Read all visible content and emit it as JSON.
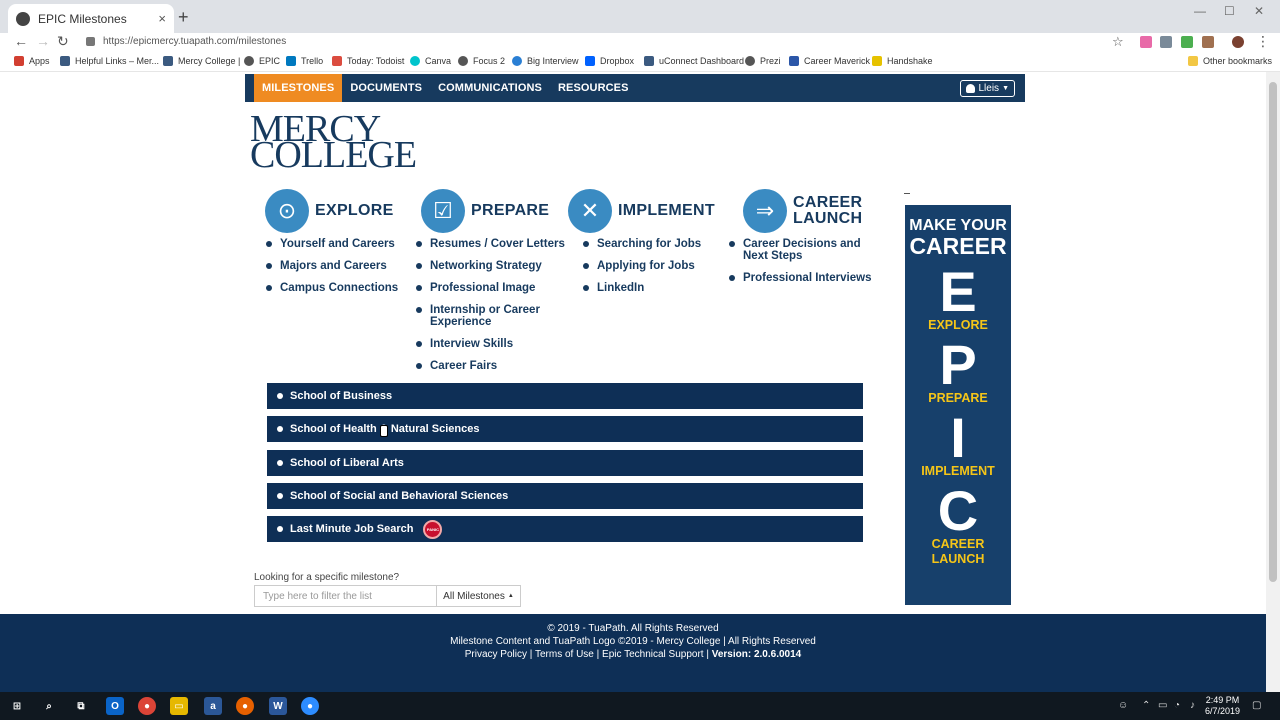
{
  "browser": {
    "tab_title": "EPIC Milestones",
    "tab_close": "×",
    "new_tab": "+",
    "url": "https://epicmercy.tuapath.com/milestones",
    "bookmarks": [
      "Apps",
      "Helpful Links – Mer...",
      "Mercy College |",
      "EPIC",
      "Trello",
      "Today: Todoist",
      "Canva",
      "Focus 2",
      "Big Interview",
      "Dropbox",
      "uConnect Dashboard",
      "Prezi",
      "Career Maverick",
      "Handshake"
    ],
    "other_bookmarks": "Other bookmarks"
  },
  "nav": {
    "items": [
      "MILESTONES",
      "DOCUMENTS",
      "COMMUNICATIONS",
      "RESOURCES"
    ],
    "active": "MILESTONES",
    "user_label": "Lleis",
    "accent_color": "#ef8b22",
    "bar_color": "#173a5e"
  },
  "logo": {
    "line1": "MERCY",
    "line2": "COLLEGE"
  },
  "categories": [
    {
      "title": "EXPLORE",
      "icon": "binoculars-icon",
      "items": [
        "Yourself and Careers",
        "Majors and Careers",
        "Campus Connections"
      ]
    },
    {
      "title": "PREPARE",
      "icon": "checklist-icon",
      "items": [
        "Resumes / Cover Letters",
        "Networking Strategy",
        "Professional Image",
        "Internship or Career Experience",
        "Interview Skills",
        "Career Fairs"
      ]
    },
    {
      "title": "IMPLEMENT",
      "icon": "tools-icon",
      "items": [
        "Searching for Jobs",
        "Applying for Jobs",
        "LinkedIn"
      ]
    },
    {
      "title_line1": "CAREER",
      "title_line2": "LAUNCH",
      "icon": "arrow-right-icon",
      "items": [
        "Career Decisions and Next Steps",
        "Professional Interviews"
      ]
    }
  ],
  "schools": [
    "School of Business",
    "School of Health & Natural Sciences",
    "School of Liberal Arts",
    "School of Social and Behavioral Sciences",
    "Last Minute Job Search"
  ],
  "panic_badge": "PANIC",
  "filter": {
    "label": "Looking for a specific milestone?",
    "placeholder": "Type here to filter the list",
    "select_value": "All Milestones"
  },
  "banner": {
    "line1": "MAKE YOUR",
    "line2": "CAREER",
    "letters": [
      {
        "letter": "E",
        "word": "EXPLORE"
      },
      {
        "letter": "P",
        "word": "PREPARE"
      },
      {
        "letter": "I",
        "word": "IMPLEMENT"
      },
      {
        "letter": "C",
        "word": "CAREER LAUNCH"
      }
    ]
  },
  "footer": {
    "copyright": "© 2019 - TuaPath. All Rights Reserved",
    "content_line": "Milestone Content and TuaPath Logo ©2019 - Mercy College | All Rights Reserved",
    "privacy": "Privacy Policy",
    "terms": "Terms of Use",
    "support": "Epic Technical Support",
    "version": "Version: 2.0.6.0014"
  },
  "taskbar": {
    "time": "2:49 PM",
    "date": "6/7/2019"
  }
}
